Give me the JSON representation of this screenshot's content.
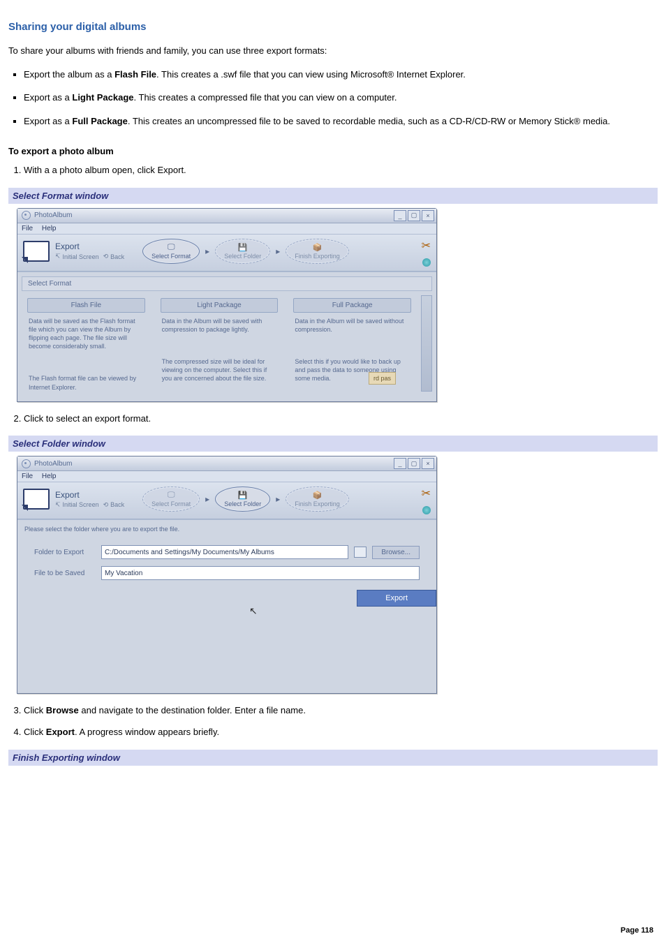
{
  "heading": "Sharing your digital albums",
  "intro": "To share your albums with friends and family, you can use three export formats:",
  "bullets": {
    "b1_pre": "Export the album as a ",
    "b1_bold": "Flash File",
    "b1_post": ". This creates a .swf file that you can view using Microsoft® Internet Explorer.",
    "b2_pre": "Export as a ",
    "b2_bold": "Light Package",
    "b2_post": ". This creates a compressed file that you can view on a computer.",
    "b3_pre": "Export as a ",
    "b3_bold": "Full Package",
    "b3_post": ". This creates an uncompressed file to be saved to recordable media, such as a CD-R/CD-RW or Memory Stick® media."
  },
  "subhead": "To export a photo album",
  "steps": {
    "s1": "With a a photo album open, click Export.",
    "s2": "Click to select an export format.",
    "s3_pre": "Click ",
    "s3_bold": "Browse",
    "s3_post": " and navigate to the destination folder. Enter a file name.",
    "s4_pre": "Click ",
    "s4_bold": "Export",
    "s4_post": ". A progress window appears briefly."
  },
  "banners": {
    "b1": "Select Format window",
    "b2": "Select Folder window",
    "b3": "Finish Exporting window"
  },
  "win": {
    "title": "PhotoAlbum",
    "menu_file": "File",
    "menu_help": "Help",
    "export": "Export",
    "initial": "Initial Screen",
    "back": "Back",
    "step_format": "Select Format",
    "step_folder": "Select Folder",
    "step_finish": "Finish Exporting"
  },
  "fmt": {
    "panel_title": "Select Format",
    "c1_btn": "Flash File",
    "c1_top": "Data will be saved as the Flash format file which you can view the Album by flipping each page. The file size will become considerably small.",
    "c1_bot": "The Flash format file can be viewed by Internet Explorer.",
    "c2_btn": "Light Package",
    "c2_top": "Data in the Album will be saved with compression to package lightly.",
    "c2_bot": "The compressed size will be ideal for viewing on the computer. Select this if you are concerned about the file size.",
    "c3_btn": "Full Package",
    "c3_top": "Data in the Album will be saved without compression.",
    "c3_bot": "Select this if you would like to back up and pass the data to someone using some media.",
    "tooltip": "rd pas"
  },
  "fld": {
    "instr": "Please select the folder where you are to export the file.",
    "lab_folder": "Folder to Export",
    "val_folder": "C:/Documents and Settings/My Documents/My Albums",
    "lab_file": "File to be Saved",
    "val_file": "My Vacation",
    "browse": "Browse...",
    "export": "Export"
  },
  "page_num": "Page 118"
}
